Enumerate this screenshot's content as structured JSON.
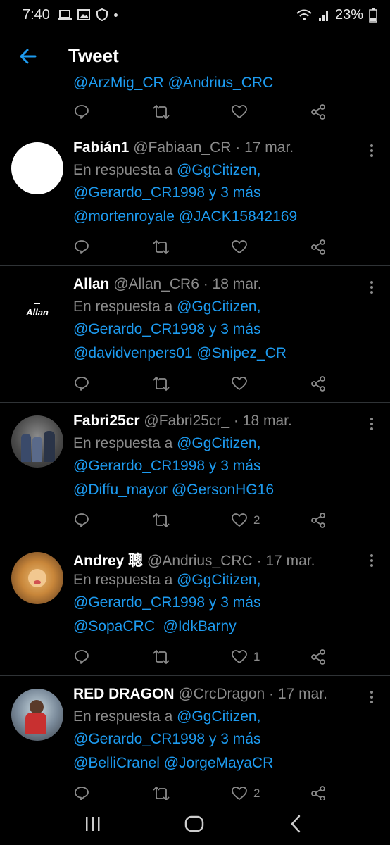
{
  "status_bar": {
    "time": "7:40",
    "battery": "23%"
  },
  "header": {
    "title": "Tweet"
  },
  "partial_tweet": {
    "mentions": "@ArzMig_CR @Andrius_CRC"
  },
  "tweets": [
    {
      "display_name": "Fabián1",
      "meta": "@Fabiaan_CR · 17 mar.",
      "reply_prefix": "En respuesta a ",
      "reply_handle": "@GgCitizen,",
      "reply_line2": "@Gerardo_CR1998 y 3 más",
      "mentions": "@mortenroyale @JACK15842169",
      "likes": ""
    },
    {
      "display_name": "Allan",
      "meta": "@Allan_CR6 · 18 mar.",
      "reply_prefix": "En respuesta a ",
      "reply_handle": "@GgCitizen,",
      "reply_line2": "@Gerardo_CR1998 y 3 más",
      "mentions": "@davidvenpers01 @Snipez_CR",
      "likes": "",
      "avatar_text": "Allan"
    },
    {
      "display_name": "Fabri25cr",
      "meta": "@Fabri25cr_ · 18 mar.",
      "reply_prefix": "En respuesta a ",
      "reply_handle": "@GgCitizen,",
      "reply_line2": "@Gerardo_CR1998 y 3 más",
      "mentions": "@Diffu_mayor @GersonHG16",
      "likes": "2"
    },
    {
      "display_name": "Andrey 聰",
      "meta": "@Andrius_CRC · 17 mar.",
      "reply_prefix": "En respuesta a ",
      "reply_handle": "@GgCitizen,",
      "reply_line2": "@Gerardo_CR1998 y 3 más",
      "mentions": "@SopaCRC  @IdkBarny",
      "likes": "1"
    },
    {
      "display_name": "RED DRAGON",
      "meta": "@CrcDragon · 17 mar.",
      "reply_prefix": "En respuesta a ",
      "reply_handle": "@GgCitizen,",
      "reply_line2": "@Gerardo_CR1998 y 3 más",
      "mentions": "@BelliCranel @JorgeMayaCR",
      "likes": "2"
    }
  ],
  "icons": [
    "back-arrow-icon",
    "reply-icon",
    "retweet-icon",
    "like-icon",
    "share-icon",
    "more-icon",
    "recent-apps-icon",
    "home-icon",
    "nav-back-icon"
  ],
  "colors": {
    "background": "#000000",
    "accent": "#1d9bf0",
    "muted": "#8b8b8b",
    "divider": "#2f3336"
  }
}
